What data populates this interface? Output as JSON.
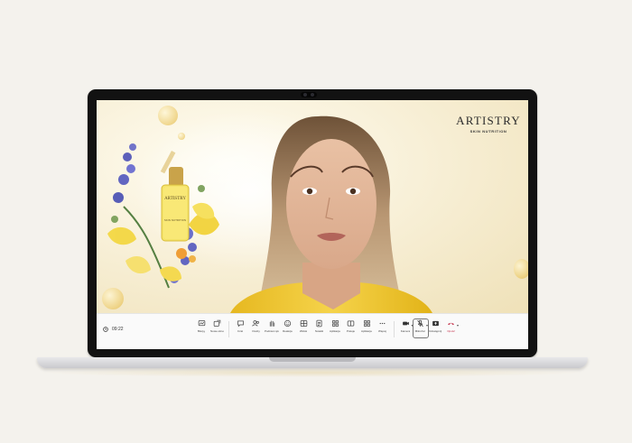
{
  "brand": {
    "name": "ARTISTRY",
    "subtitle": "SKIN NUTRITION"
  },
  "product": {
    "label_top": "ARTISTRY",
    "label_bottom": "SKIN NUTRITION"
  },
  "call": {
    "elapsed": "09:22"
  },
  "toolbar": {
    "groups": [
      [
        {
          "name": "tb-item-1",
          "label": "Biletyy",
          "icon": "whiteboard-icon"
        },
        {
          "name": "tb-item-2",
          "label": "Nowe okno",
          "icon": "new-window-icon"
        }
      ],
      [
        {
          "name": "tb-item-3",
          "label": "Czat",
          "icon": "chat-icon"
        },
        {
          "name": "tb-item-4",
          "label": "Osoby",
          "icon": "people-icon"
        },
        {
          "name": "tb-item-5",
          "label": "Podnieś rękę",
          "icon": "raise-hand-icon"
        },
        {
          "name": "tb-item-6",
          "label": "Reakcje",
          "icon": "reactions-icon"
        },
        {
          "name": "tb-item-7",
          "label": "Widok",
          "icon": "view-icon"
        },
        {
          "name": "tb-item-8",
          "label": "Notatki",
          "icon": "notes-icon"
        },
        {
          "name": "tb-item-9",
          "label": "Aplikacje",
          "icon": "apps-icon"
        },
        {
          "name": "tb-item-10",
          "label": "Pokoje",
          "icon": "rooms-icon"
        },
        {
          "name": "tb-item-11",
          "label": "Aplikacje",
          "icon": "apps-icon"
        },
        {
          "name": "tb-item-12",
          "label": "Więcej",
          "icon": "more-icon"
        }
      ],
      [
        {
          "name": "tb-item-13",
          "label": "Kamera",
          "icon": "camera-icon",
          "caret": true
        },
        {
          "name": "tb-item-14",
          "label": "Mikrofon",
          "icon": "mic-icon",
          "caret": true,
          "active": true
        },
        {
          "name": "tb-item-15",
          "label": "Udostępnij",
          "icon": "share-icon"
        },
        {
          "name": "tb-item-16",
          "label": "Opuść",
          "icon": "leave-icon",
          "caret": true,
          "color": "#c4314b"
        }
      ]
    ]
  }
}
